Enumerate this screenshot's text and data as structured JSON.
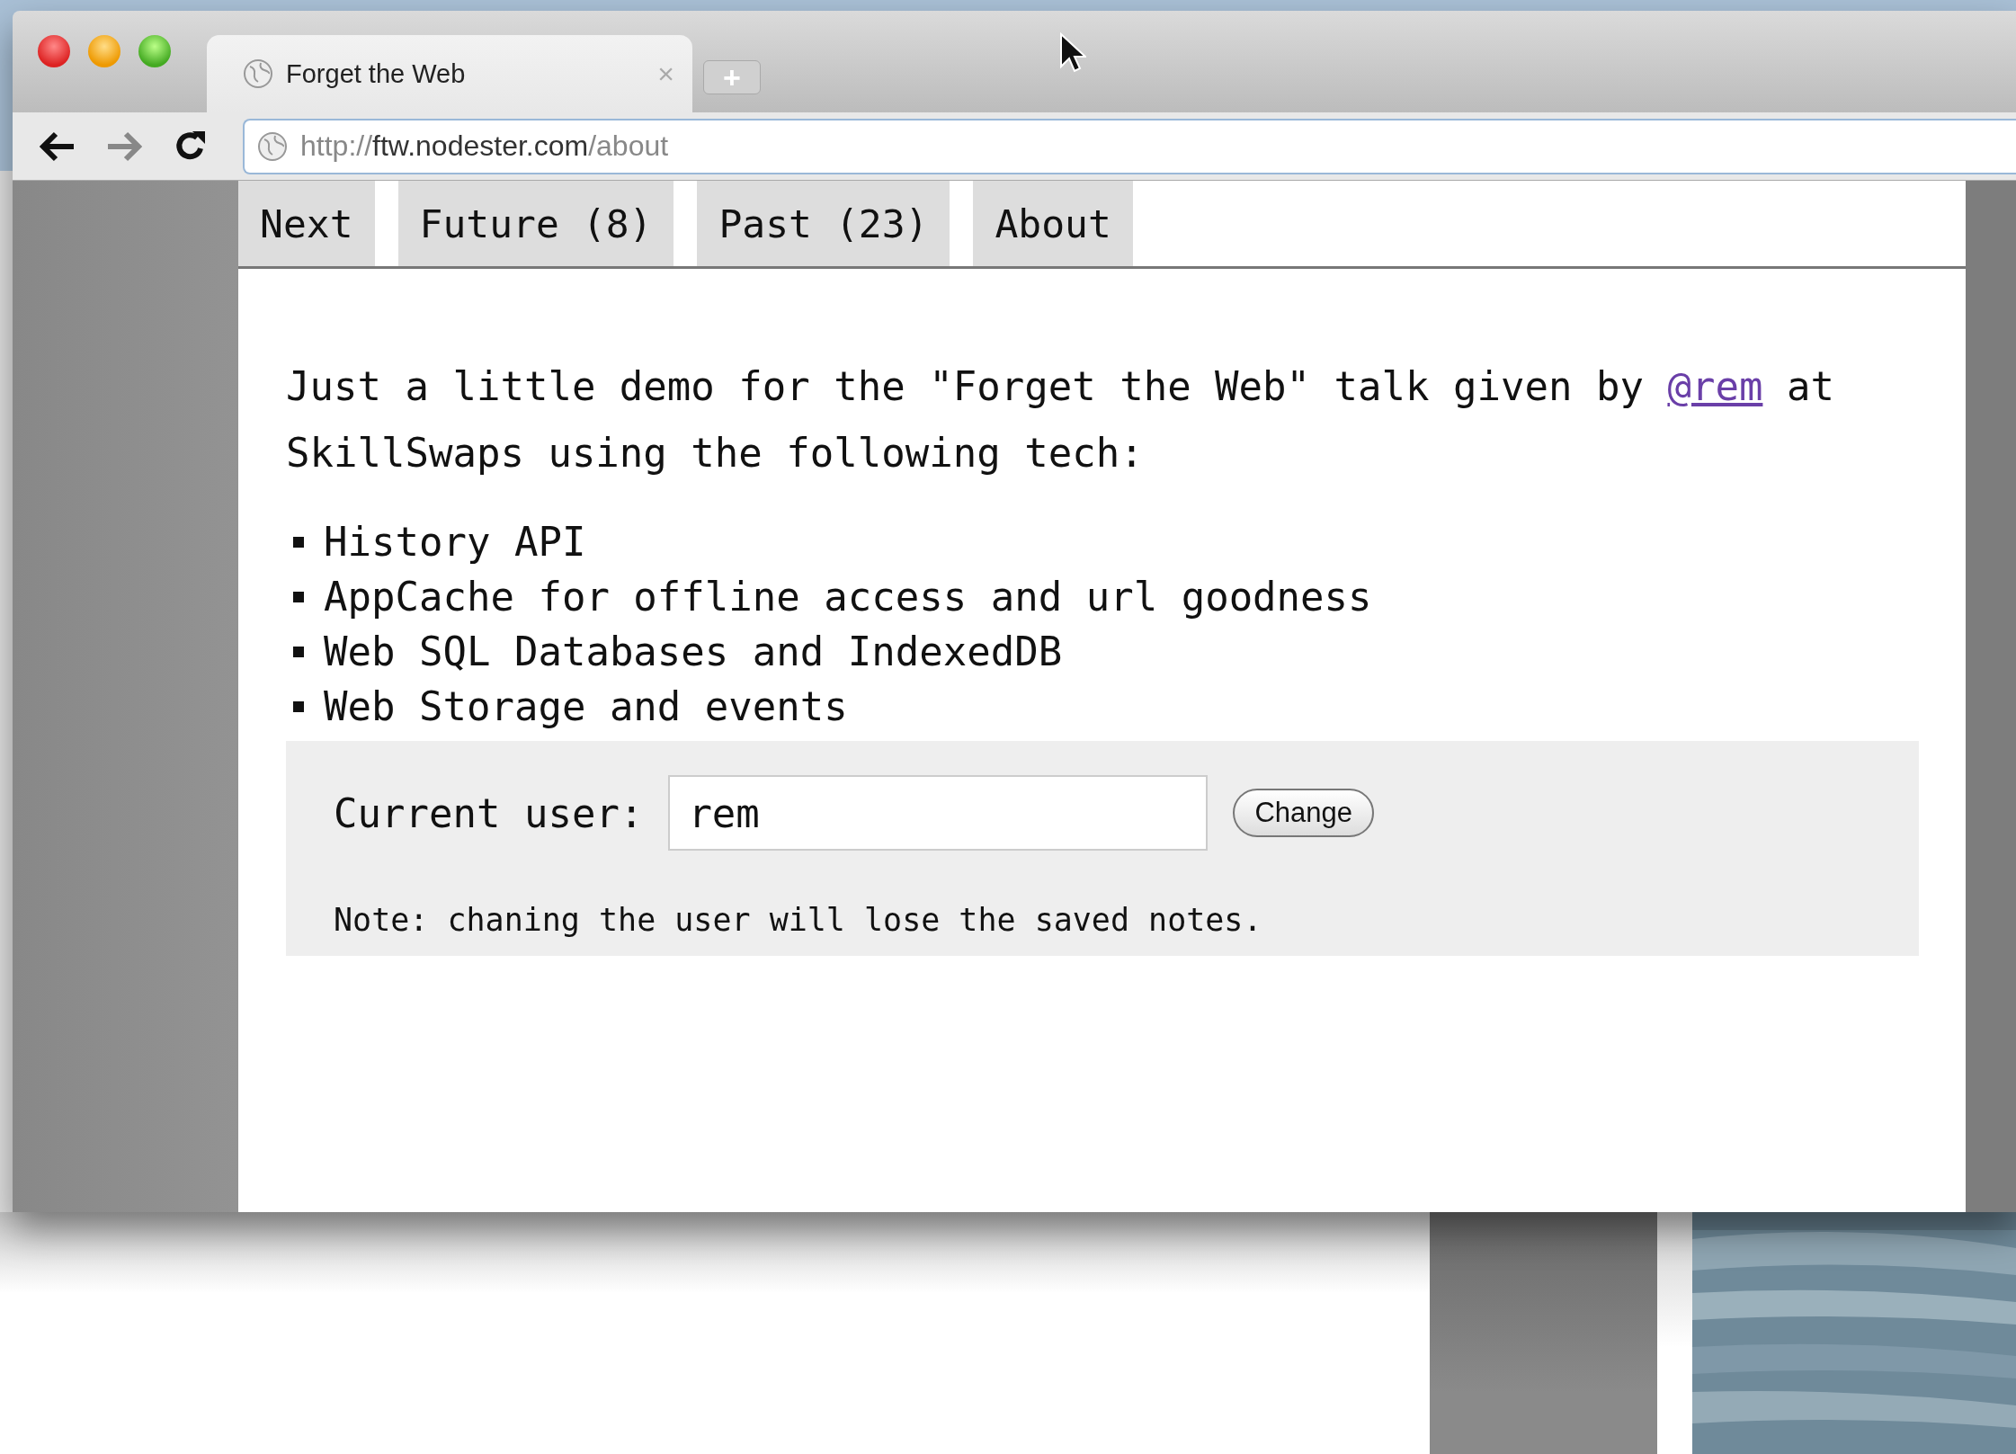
{
  "browser": {
    "tab": {
      "title": "Forget the Web",
      "close": "×"
    },
    "new_tab": "+",
    "address_bar": {
      "scheme": "http://",
      "host": "ftw.nodester.com",
      "path": "/about"
    }
  },
  "page": {
    "nav": [
      {
        "label": "Next"
      },
      {
        "label": "Future (8)"
      },
      {
        "label": "Past (23)"
      },
      {
        "label": "About"
      }
    ],
    "intro": {
      "before": "Just a little demo for the \"Forget the Web\" talk given by ",
      "link": "@rem",
      "after": " at SkillSwaps using the following tech:"
    },
    "features": [
      "History API",
      "AppCache for offline access and url goodness",
      "Web SQL Databases and IndexedDB",
      "Web Storage and events"
    ],
    "user_form": {
      "label": "Current user:",
      "value": "rem",
      "button": "Change",
      "note": "Note: chaning the user will lose the saved notes."
    }
  }
}
